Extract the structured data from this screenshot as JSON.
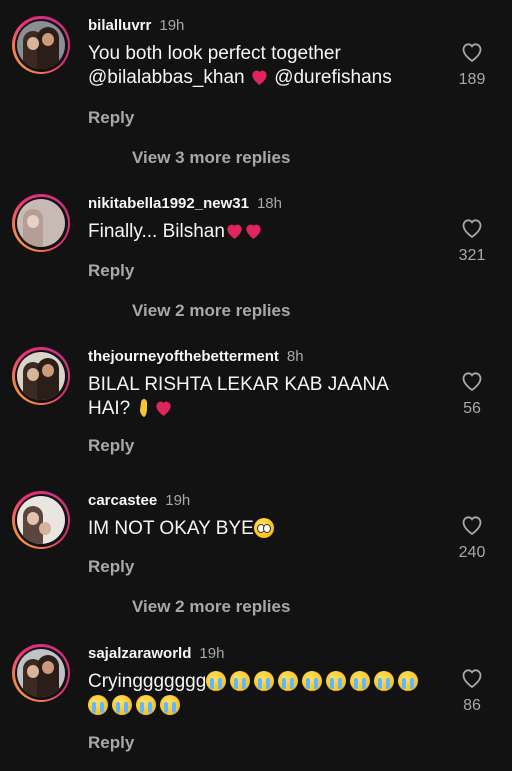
{
  "comments": [
    {
      "username": "bilalluvrr",
      "time": "19h",
      "text": "You both look perfect together @bilalabbas_khan",
      "text_suffix": "@durefishans",
      "likes": "189",
      "reply_label": "Reply",
      "more_replies": "View 3 more replies"
    },
    {
      "username": "nikitabella1992_new31",
      "time": "18h",
      "text": "Finally... Bilshan",
      "likes": "321",
      "reply_label": "Reply",
      "more_replies": "View 2 more replies"
    },
    {
      "username": "thejourneyofthebetterment",
      "time": "8h",
      "text": "BILAL RISHTA LEKAR KAB JAANA HAI?",
      "likes": "56",
      "reply_label": "Reply"
    },
    {
      "username": "carcastee",
      "time": "19h",
      "text": "IM NOT OKAY BYE",
      "likes": "240",
      "reply_label": "Reply",
      "more_replies": "View 2 more replies"
    },
    {
      "username": "sajalzaraworld",
      "time": "19h",
      "text": "Cryinggggggg",
      "likes": "86",
      "reply_label": "Reply"
    }
  ],
  "icons": {
    "like": "heart-outline-icon",
    "heart_emoji": "red-heart-icon",
    "crying_emoji": "loudly-crying-face-icon",
    "pleading_emoji": "pleading-face-icon",
    "pinch_emoji": "pinched-fingers-icon"
  },
  "colors": {
    "background": "#121212",
    "primary_text": "#f5f5f5",
    "secondary_text": "#a8a8a8",
    "heart_red": "#e0245e"
  }
}
